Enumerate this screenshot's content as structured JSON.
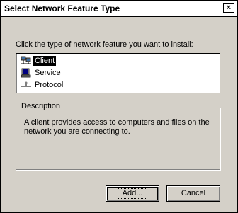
{
  "window": {
    "title": "Select Network Feature Type",
    "close_glyph": "×"
  },
  "instruction": "Click the type of network feature you want to install:",
  "feature_list": {
    "items": [
      {
        "label": "Client",
        "icon": "network-client-icon",
        "selected": true
      },
      {
        "label": "Service",
        "icon": "network-service-icon",
        "selected": false
      },
      {
        "label": "Protocol",
        "icon": "network-protocol-icon",
        "selected": false
      }
    ]
  },
  "description": {
    "legend": "Description",
    "text": "A client provides access to computers and files on the network you are connecting to."
  },
  "buttons": {
    "add": "Add...",
    "cancel": "Cancel"
  }
}
